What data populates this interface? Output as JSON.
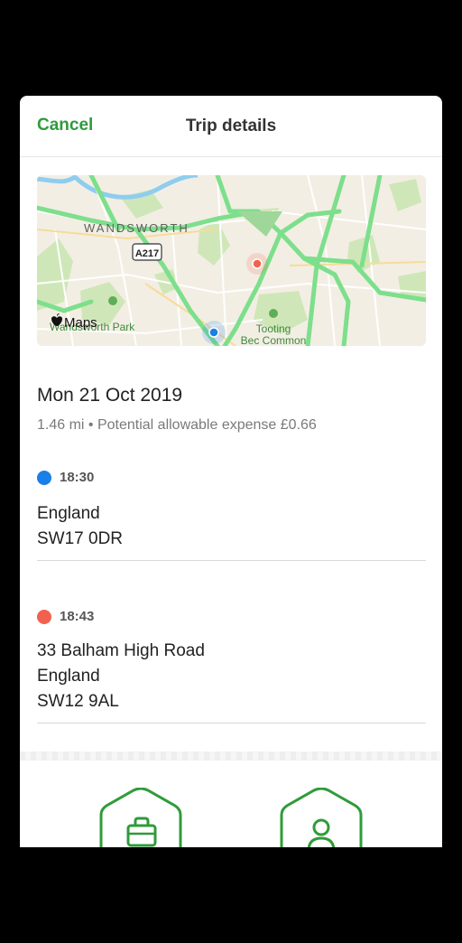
{
  "nav": {
    "cancel_label": "Cancel",
    "title": "Trip details"
  },
  "map": {
    "labels": {
      "district": "WANDSWORTH",
      "road": "A217",
      "park": "Wandsworth Park",
      "common_line1": "Tooting",
      "common_line2": "Bec Common",
      "attribution": "Maps"
    }
  },
  "trip": {
    "date": "Mon 21 Oct 2019",
    "summary": "1.46 mi • Potential allowable expense £0.66",
    "start": {
      "time": "18:30",
      "line1": "England",
      "line2": "SW17 0DR",
      "color": "#1a7fe8"
    },
    "end": {
      "time": "18:43",
      "line1": "33 Balham High Road",
      "line2": "England",
      "line3": "SW12 9AL",
      "color": "#f0624d"
    }
  },
  "actions": {
    "business_icon": "briefcase-icon",
    "personal_icon": "person-icon"
  },
  "colors": {
    "accent": "#2f9b3a",
    "route": "#7ddf8c",
    "water": "#8ecdf0"
  }
}
